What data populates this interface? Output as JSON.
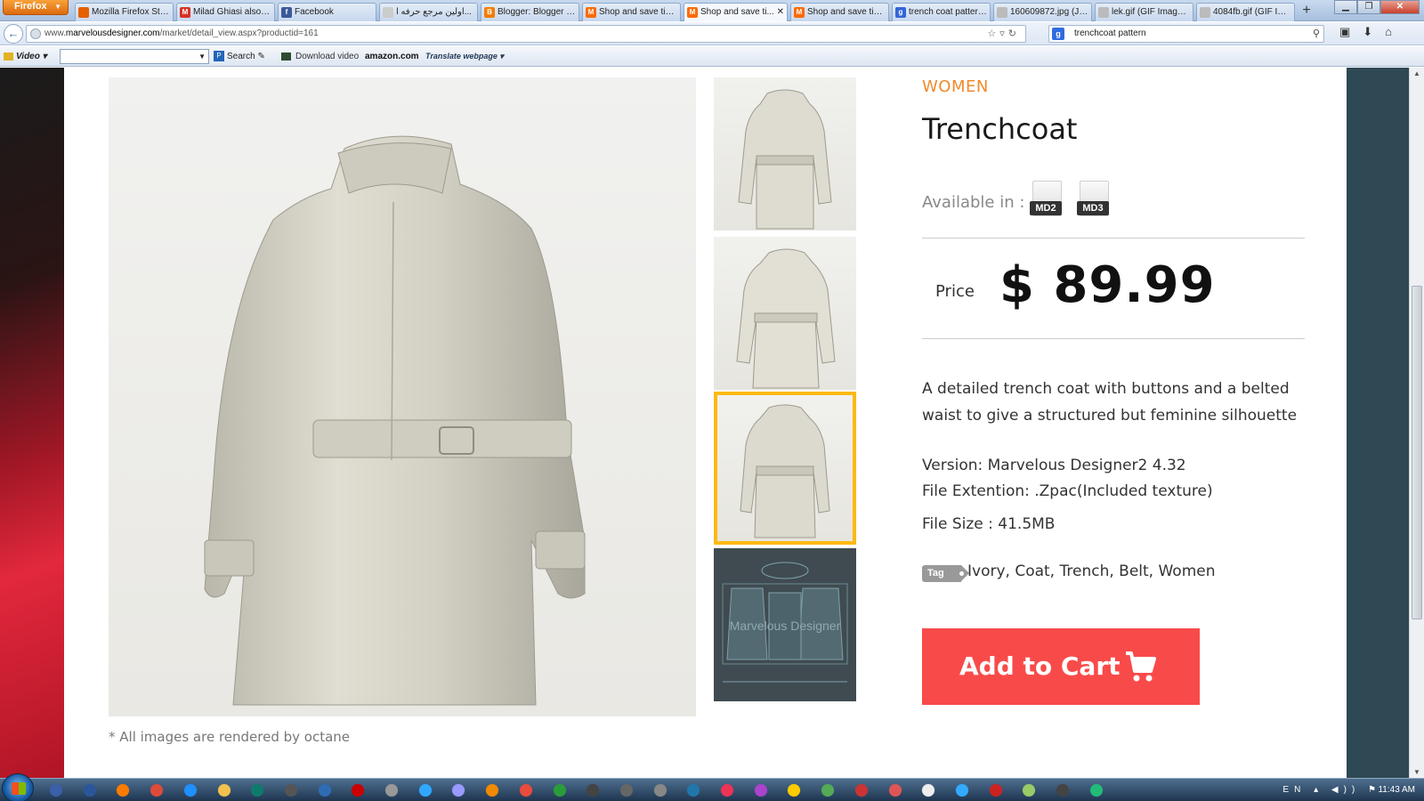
{
  "browser": {
    "menu_label": "Firefox",
    "tabs": [
      {
        "label": "Mozilla Firefox Start...",
        "fav": "firefox-icon",
        "color": "#e66000",
        "glyph": ""
      },
      {
        "label": "Milad Ghiasi also c...",
        "fav": "gmail-icon",
        "color": "#d93025",
        "glyph": "M"
      },
      {
        "label": "Facebook",
        "fav": "facebook-icon",
        "color": "#3b5998",
        "glyph": "f"
      },
      {
        "label": "اولین مرجع حرفه ا...",
        "fav": "page-icon",
        "color": "#cccccc",
        "glyph": ""
      },
      {
        "label": "Blogger: Blogger D...",
        "fav": "blogger-icon",
        "color": "#f57d00",
        "glyph": "B"
      },
      {
        "label": "Shop and save time...",
        "fav": "marvelous-icon",
        "color": "#ff6a00",
        "glyph": "M"
      },
      {
        "label": "Shop and save ti...",
        "fav": "marvelous-icon",
        "color": "#ff6a00",
        "glyph": "M",
        "active": true
      },
      {
        "label": "Shop and save time...",
        "fav": "marvelous-icon",
        "color": "#ff6a00",
        "glyph": "M"
      },
      {
        "label": "trench coat pattern...",
        "fav": "google-icon",
        "color": "#3367d6",
        "glyph": "g"
      },
      {
        "label": "160609872.jpg (JPE...",
        "fav": "image-icon",
        "color": "#bbbbbb",
        "glyph": ""
      },
      {
        "label": "lek.gif (GIF Image, ...",
        "fav": "image-icon",
        "color": "#bbbbbb",
        "glyph": ""
      },
      {
        "label": "4084fb.gif (GIF Ima...",
        "fav": "image-icon",
        "color": "#bbbbbb",
        "glyph": ""
      }
    ],
    "new_tab": "+",
    "url_prefix": "www.",
    "url_domain": "marvelousdesigner.com",
    "url_path": "/market/detail_view.aspx?productid=161",
    "search_text": "trenchcoat pattern"
  },
  "toolbar": {
    "video_label": "Video",
    "search_label": "Search",
    "download_label": "Download video",
    "amazon_label": "amazon.com",
    "translate_label": "Translate webpage"
  },
  "product": {
    "category": "WOMEN",
    "title": "Trenchcoat",
    "available_label": "Available in :",
    "formats": [
      "MD2",
      "MD3"
    ],
    "price_label": "Price",
    "price_value": "$ 89.99",
    "description": "A detailed trench coat with buttons and a belted waist to give a structured but feminine silhouette",
    "version": "Version: Marvelous Designer2 4.32",
    "file_extension": "File Extention: .Zpac(Included texture)",
    "file_size": "File Size : 41.5MB",
    "tag_label": "Tag",
    "tags": "Ivory, Coat, Trench, Belt, Women",
    "cart_label": "Add to Cart",
    "caption": "* All images are rendered by octane",
    "thumb_watermark": "Marvelous Designer",
    "selected_thumb": 3
  },
  "taskbar": {
    "language": "EN",
    "clock": "11:43 AM"
  },
  "colors": {
    "accent": "#f08a2c",
    "cart": "#f94a4a",
    "selected_border": "#fdb913"
  }
}
